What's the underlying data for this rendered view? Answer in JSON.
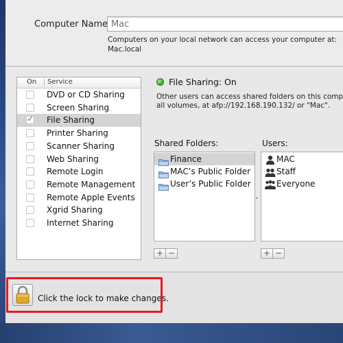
{
  "computer_name": {
    "label": "Computer Name:",
    "placeholder": "Mac",
    "description": "Computers on your local network can access your computer at: Mac.local"
  },
  "services": {
    "header_on": "On",
    "header_service": "Service",
    "items": [
      {
        "name": "DVD or CD Sharing",
        "on": false,
        "selected": false
      },
      {
        "name": "Screen Sharing",
        "on": false,
        "selected": false
      },
      {
        "name": "File Sharing",
        "on": true,
        "selected": true
      },
      {
        "name": "Printer Sharing",
        "on": false,
        "selected": false
      },
      {
        "name": "Scanner Sharing",
        "on": false,
        "selected": false
      },
      {
        "name": "Web Sharing",
        "on": false,
        "selected": false
      },
      {
        "name": "Remote Login",
        "on": false,
        "selected": false
      },
      {
        "name": "Remote Management",
        "on": false,
        "selected": false
      },
      {
        "name": "Remote Apple Events",
        "on": false,
        "selected": false
      },
      {
        "name": "Xgrid Sharing",
        "on": false,
        "selected": false
      },
      {
        "name": "Internet Sharing",
        "on": false,
        "selected": false
      }
    ]
  },
  "status": {
    "title": "File Sharing: On",
    "description_line1": "Other users can access shared folders on this compute",
    "description_line2": "all volumes, at afp://192.168.190.132/ or \"Mac\".",
    "color": "#3fae2b"
  },
  "shared_folders": {
    "label": "Shared Folders:",
    "items": [
      {
        "name": "Finance",
        "selected": true
      },
      {
        "name": "MAC’s Public Folder",
        "selected": false
      },
      {
        "name": "User’s Public Folder",
        "selected": false
      }
    ]
  },
  "users": {
    "label": "Users:",
    "items": [
      {
        "name": "MAC",
        "icon": "single-user-icon"
      },
      {
        "name": "Staff",
        "icon": "group-icon"
      },
      {
        "name": "Everyone",
        "icon": "everyone-icon"
      }
    ]
  },
  "buttons": {
    "add": "+",
    "remove": "−"
  },
  "lock": {
    "text": "Click the lock to make changes.",
    "icon": "lock-icon"
  },
  "highlight_color": "#e8191f"
}
